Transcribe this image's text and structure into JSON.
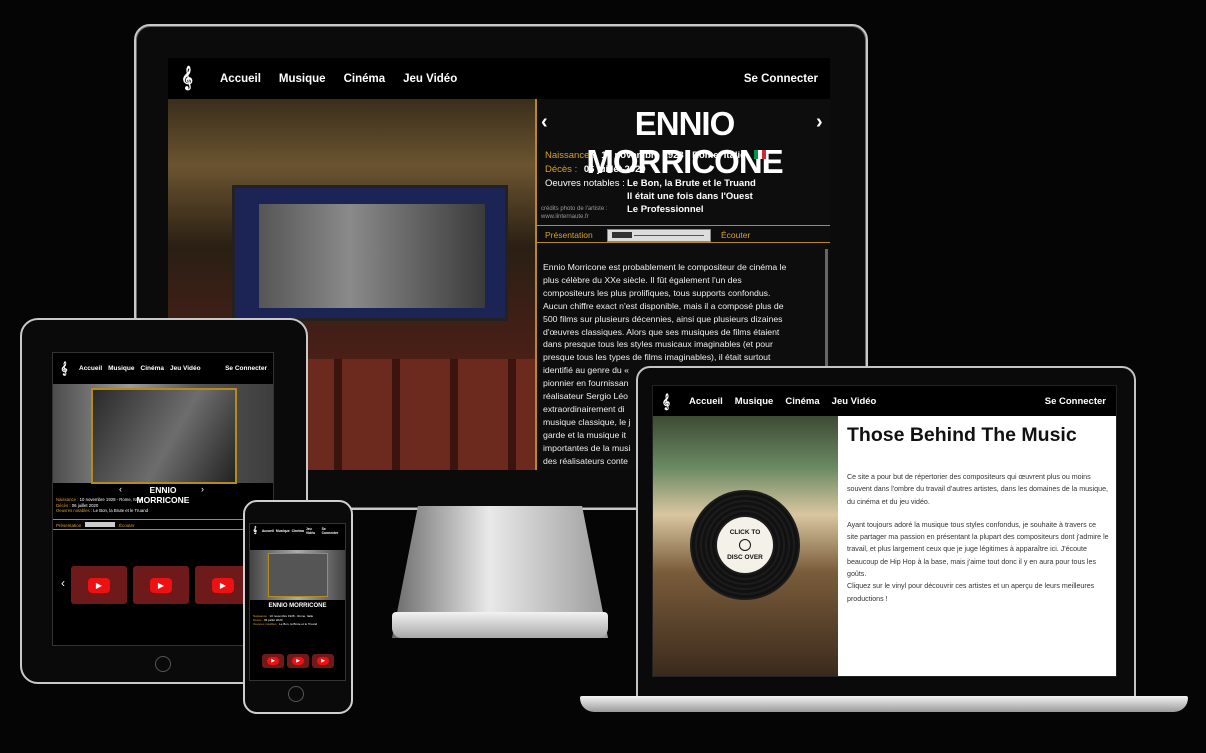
{
  "nav": {
    "logo_icon": "treble-clef-icon",
    "items": [
      "Accueil",
      "Musique",
      "Cinéma",
      "Jeu Vidéo"
    ],
    "login": "Se Connecter"
  },
  "artist": {
    "name": "ENNIO MORRICONE",
    "birth_label": "Naissance :",
    "birth_value": "10 novembre 1928 - Rome, Italie",
    "death_label": "Décès :",
    "death_value": "06 juillet 2020",
    "works_label": "Oeuvres notables :",
    "works": [
      "Le Bon, la Brute et le Truand",
      "Il était une fois dans l'Ouest",
      "Le Professionnel"
    ],
    "credit_line1": "crédits photo de l'artiste :",
    "credit_line2": "www.linternaute.fr",
    "tab_presentation": "Présentation",
    "tab_listen": "Écouter",
    "flag_colors": [
      "#009246",
      "#ffffff",
      "#ce2b37"
    ],
    "bio_lines": [
      "Ennio Morricone est probablement le compositeur de cinéma le",
      "plus célèbre du XXe siècle. Il fût également l'un des",
      "compositeurs les plus prolifiques, tous supports confondus.",
      "Aucun chiffre exact n'est disponible, mais il a composé plus de",
      "500 films sur plusieurs décennies, ainsi que plusieurs dizaines",
      "d'œuvres classiques. Alors que ses musiques de films étaient",
      "dans presque tous les styles musicaux imaginables (et pour",
      "presque tous les types de films imaginables), il était surtout",
      "identifié au genre du «",
      "pionnier en fournissan",
      "réalisateur Sergio Léo",
      "extraordinairement di",
      "musique classique, le j",
      "garde et la musique it",
      "importantes de la musi",
      "des réalisateurs conte"
    ]
  },
  "home": {
    "title": "Those Behind The Music",
    "p1": "Ce site a pour but de répertorier des compositeurs qui œuvrent plus ou moins souvent dans l'ombre du travail d'autres artistes, dans les domaines de la musique, du cinéma et du jeu vidéo.",
    "p2": "Ayant toujours adoré la musique tous styles confondus, je souhaite à travers ce site partager ma passion en présentant la plupart des compositeurs dont j'admire le travail, et plus largement ceux que je juge légitimes à apparaître ici. J'écoute beaucoup de Hip Hop à la base, mais j'aime tout donc il y en aura pour tous les goûts.",
    "p3": "Cliquez sur le vinyl pour découvrir ces artistes et un aperçu de leurs meilleures productions !",
    "vinyl_top": "CLICK TO",
    "vinyl_bottom": "DISC OVER"
  },
  "icons": {
    "prev": "‹",
    "next": "›",
    "play": "▶"
  }
}
